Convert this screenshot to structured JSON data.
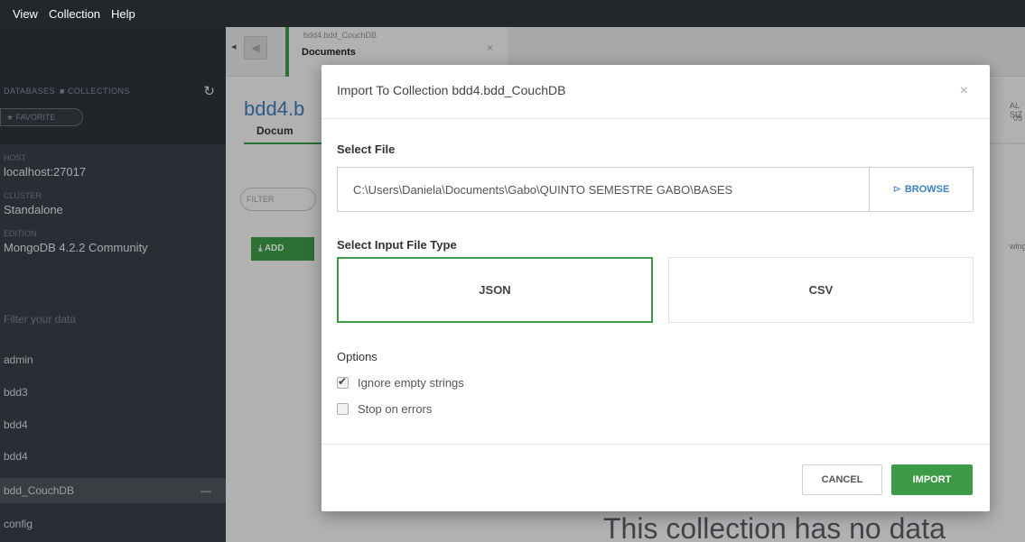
{
  "menubar": {
    "items": [
      "View",
      "Collection",
      "Help"
    ]
  },
  "sidebar": {
    "stats": [
      "DATABASES",
      "■ COLLECTIONS"
    ],
    "refresh_icon": "↻",
    "favorite_label": "★ FAVORITE",
    "info": [
      {
        "label": "HOST",
        "value": "localhost:27017"
      },
      {
        "label": "CLUSTER",
        "value": "Standalone"
      },
      {
        "label": "EDITION",
        "value": "MongoDB 4.2.2 Community"
      }
    ],
    "filter_placeholder": "Filter your data",
    "databases": [
      "admin",
      "bdd3",
      "bdd4",
      "bdd4"
    ],
    "active_collection": "bdd_CouchDB",
    "active_collection_action": "—",
    "bottom_item": "config"
  },
  "tab": {
    "namespace": "bdd4.bdd_CouchDB",
    "label": "Documents",
    "close": "×"
  },
  "collection_title": "bdd4.b",
  "subtab_label": "Docum",
  "filter_pill": "FILTER",
  "add_button": "⤓ ADD",
  "right_fragments": {
    "top1": "AL SIZ",
    "top2": "05",
    "side": "wing"
  },
  "empty_message": "This collection has no data",
  "modal": {
    "title": "Import To Collection bdd4.bdd_CouchDB",
    "close": "×",
    "select_file_label": "Select File",
    "file_path": "C:\\Users\\Daniela\\Documents\\Gabo\\QUINTO SEMESTRE GABO\\BASES",
    "browse_icon": "⊳",
    "browse_label": "BROWSE",
    "input_type_label": "Select Input File Type",
    "types": [
      {
        "label": "JSON",
        "selected": true
      },
      {
        "label": "CSV",
        "selected": false
      }
    ],
    "options_label": "Options",
    "options": [
      {
        "label": "Ignore empty strings",
        "checked": true
      },
      {
        "label": "Stop on errors",
        "checked": false
      }
    ],
    "cancel_label": "CANCEL",
    "import_label": "IMPORT"
  },
  "colors": {
    "accent_green": "#3d9b48",
    "link_blue": "#3d7fbf",
    "sidebar_bg": "#3b4148",
    "menubar_bg": "#23272c"
  }
}
